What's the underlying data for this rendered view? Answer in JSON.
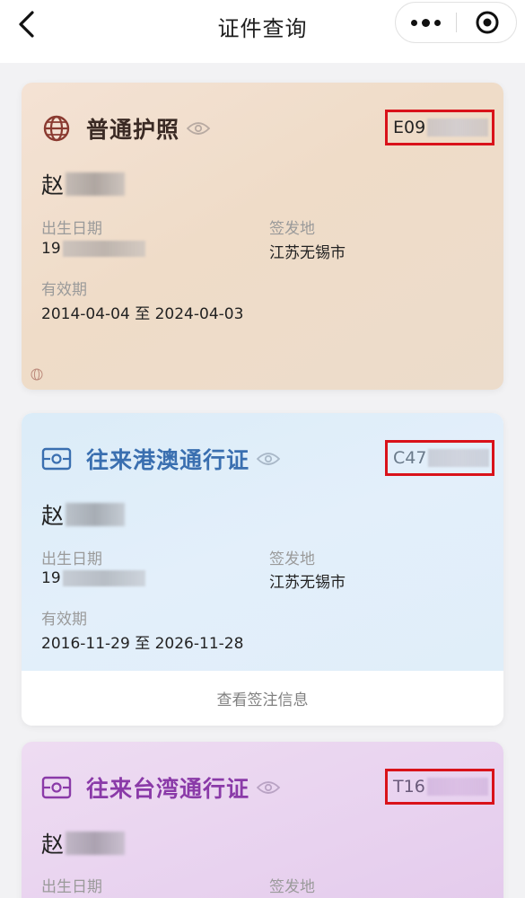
{
  "nav": {
    "title": "证件查询",
    "back_icon": "chevron-left-icon",
    "more_icon": "more-dots-icon",
    "close_icon": "target-close-icon"
  },
  "cards": [
    {
      "type": "passport",
      "title": "普通护照",
      "icon": "globe-icon",
      "accent": "#8a3a30",
      "number_prefix": "E09",
      "name_prefix": "赵",
      "birth_label": "出生日期",
      "birth_prefix": "19",
      "issue_label": "签发地",
      "issue_value": "江苏无锡市",
      "validity_label": "有效期",
      "validity_value": "2014-04-04 至 2024-04-03"
    },
    {
      "type": "hk-macau-permit",
      "title": "往来港澳通行证",
      "icon": "id-card-icon",
      "accent": "#3a6fb0",
      "number_prefix": "C47",
      "name_prefix": "赵",
      "birth_label": "出生日期",
      "birth_prefix": "19",
      "issue_label": "签发地",
      "issue_value": "江苏无锡市",
      "validity_label": "有效期",
      "validity_value": "2016-11-29 至 2026-11-28",
      "visa_link": "查看签注信息"
    },
    {
      "type": "taiwan-permit",
      "title": "往来台湾通行证",
      "icon": "id-card-icon",
      "accent": "#8a3aa8",
      "number_prefix": "T16",
      "name_prefix": "赵",
      "birth_label": "出生日期",
      "issue_label": "签发地"
    }
  ],
  "colors": {
    "highlight_box": "#d9121a"
  }
}
